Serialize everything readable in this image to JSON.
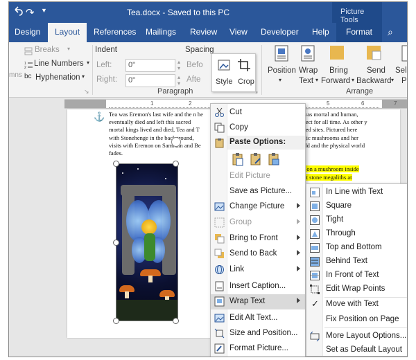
{
  "window": {
    "title": "Tea.docx  -  Saved to this PC",
    "context_tab_group": "Picture Tools"
  },
  "tabs": [
    "Design",
    "Layout",
    "References",
    "Mailings",
    "Review",
    "View",
    "Developer",
    "Help",
    "Format"
  ],
  "tell_me_glyph": "⌕",
  "ribbon": {
    "page_setup": {
      "breaks": "Breaks",
      "line_numbers": "Line Numbers",
      "hyphenation": "Hyphenation",
      "partial_left": "mns"
    },
    "indent": {
      "label": "Indent",
      "left_label": "Left:",
      "left_value": "0\"",
      "right_label": "Right:",
      "right_value": "0\""
    },
    "spacing": {
      "label": "Spacing",
      "before_partial": "Befo",
      "after_partial": "Afte"
    },
    "paragraph_group": "Paragraph",
    "arrange": {
      "position": "Position",
      "wrap_text_1": "Wrap",
      "wrap_text_2": "Text",
      "bring_forward_1": "Bring",
      "bring_forward_2": "Forward",
      "send_backward_1": "Send",
      "send_backward_2": "Backward",
      "select_partial_1": "Sele",
      "select_partial_2": "P",
      "group_label": "Arrange"
    }
  },
  "ruler": {
    "marks": [
      "1",
      "2",
      "5",
      "6",
      "7"
    ]
  },
  "document": {
    "left_column": "Tea was Eremon's last wife and the n he eventually died and left this sacred mortal kings lived and died, Tea and T with Stonehenge in the background, visits with Eremon on Samhain and Be fades.",
    "right_column": "he was mortal and human, protect for all time. As other y sacred sites. Pictured here magic mushrooms and her world and the physical world",
    "highlighted_1": "ting on a mushroom inside",
    "highlighted_2": "giant stone megaliths at"
  },
  "mini_toolbar": {
    "style": "Style",
    "crop": "Crop"
  },
  "context_menu": {
    "cut": "Cut",
    "copy": "Copy",
    "paste_options": "Paste Options:",
    "edit_picture": "Edit Picture",
    "save_as_picture": "Save as Picture...",
    "change_picture": "Change Picture",
    "group": "Group",
    "bring_to_front": "Bring to Front",
    "send_to_back": "Send to Back",
    "link": "Link",
    "insert_caption": "Insert Caption...",
    "wrap_text": "Wrap Text",
    "edit_alt_text": "Edit Alt Text...",
    "size_and_position": "Size and Position...",
    "format_picture": "Format Picture..."
  },
  "wrap_submenu": {
    "in_line_with_text": "In Line with Text",
    "square": "Square",
    "tight": "Tight",
    "through": "Through",
    "top_and_bottom": "Top and Bottom",
    "behind_text": "Behind Text",
    "in_front_of_text": "In Front of Text",
    "edit_wrap_points": "Edit Wrap Points",
    "move_with_text": "Move with Text",
    "fix_position_on_page": "Fix Position on Page",
    "more_layout_options": "More Layout Options...",
    "set_as_default_layout": "Set as Default Layout",
    "checkmark": "✓"
  },
  "colors": {
    "word_blue": "#2b579a",
    "ribbon_bg": "#f3f3f3",
    "highlight": "#ffff00"
  }
}
